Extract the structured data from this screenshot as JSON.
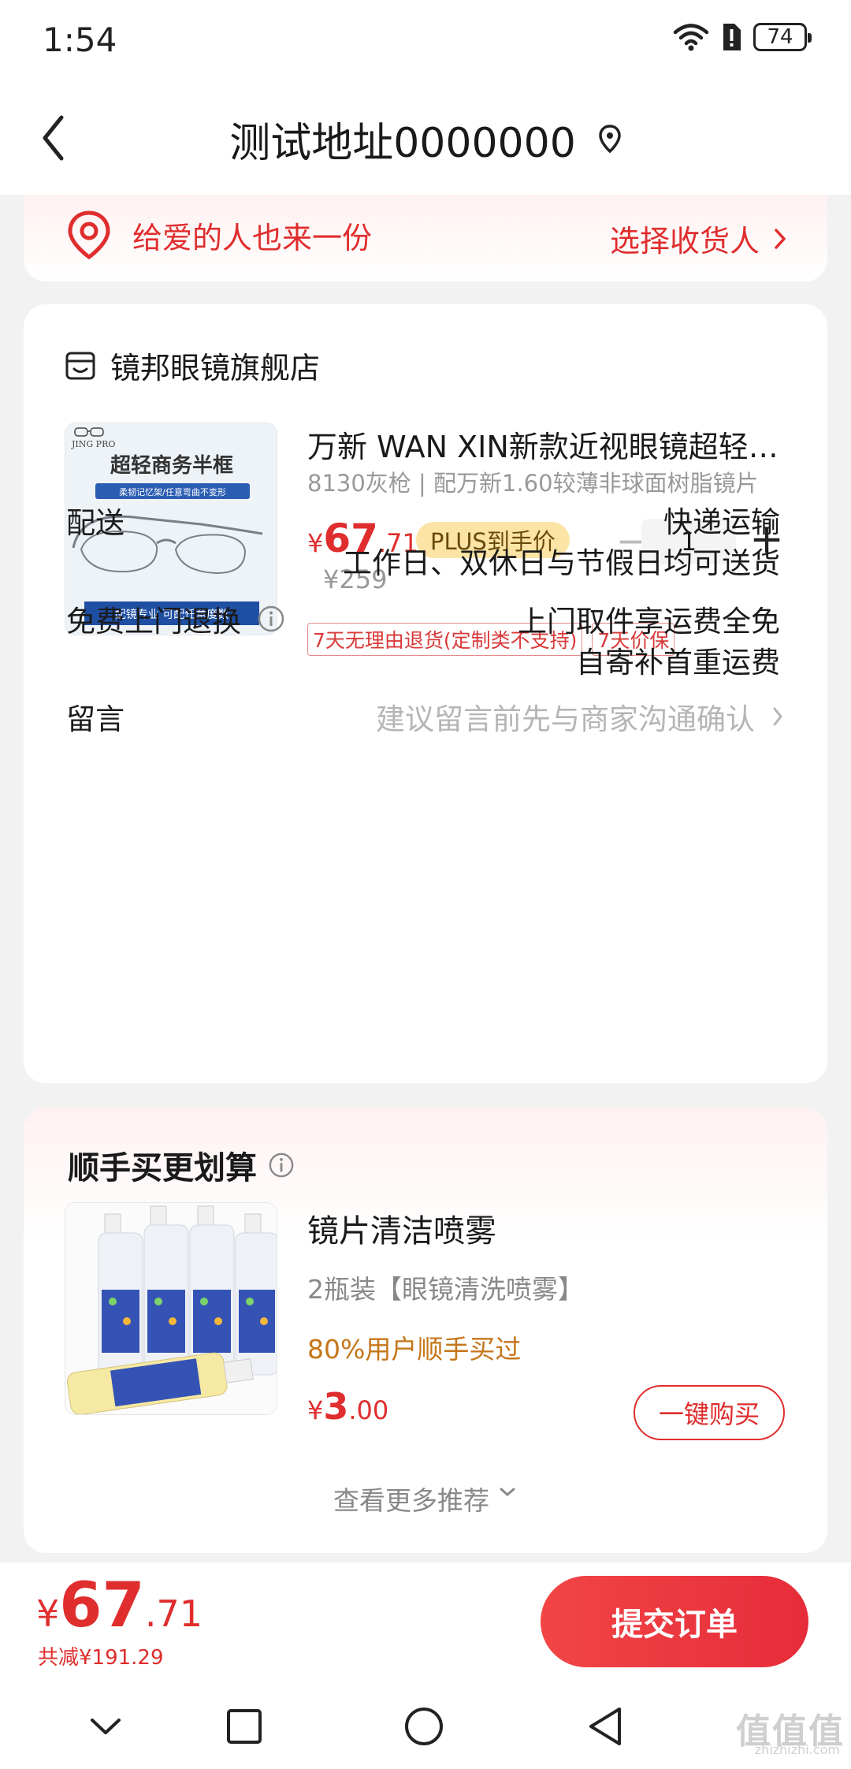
{
  "status_bar": {
    "time": "1:54",
    "battery": "74"
  },
  "header": {
    "title": "测试地址0000000"
  },
  "address_banner": {
    "left_text": "给爱的人也来一份",
    "right_text": "选择收货人"
  },
  "store": {
    "name": "镜邦眼镜旗舰店",
    "product": {
      "image_brand": "JING PRO",
      "image_headline": "超轻商务半框",
      "image_sub": "柔韧记忆架/任意弯曲不变形",
      "image_footer": "配镜专业 可配任意度数",
      "title": "万新 WAN XIN新款近视眼镜超轻商务半框",
      "spec": "8130灰枪 | 配万新1.60较薄非球面树脂镜片",
      "price_symbol": "¥",
      "price_int": "67",
      "price_dec": ".71",
      "plus_tag": "PLUS到手价",
      "quantity": "1",
      "minus_label": "−",
      "plus_label": "+",
      "original_price": "¥259",
      "tags": [
        "7天无理由退货(定制类不支持)",
        "7天价保"
      ]
    },
    "delivery": {
      "label": "配送",
      "value1": "快递运输",
      "value2": "工作日、双休日与节假日均可送货"
    },
    "return_service": {
      "label": "免费上门退换",
      "value1": "上门取件享运费全免",
      "value2": "自寄补首重运费"
    },
    "message": {
      "label": "留言",
      "placeholder": "建议留言前先与商家沟通确认"
    }
  },
  "recommend": {
    "title": "顺手买更划算",
    "item": {
      "name": "镜片清洁喷雾",
      "spec": "2瓶装【眼镜清洗喷雾】",
      "social": "80%用户顺手买过",
      "price_symbol": "¥",
      "price_int": "3",
      "price_dec": ".00",
      "buy_label": "一键购买"
    },
    "more_label": "查看更多推荐"
  },
  "bottom_bar": {
    "price_symbol": "¥",
    "price_int": "67",
    "price_dec": ".71",
    "saved": "共减¥191.29",
    "submit_label": "提交订单"
  },
  "watermark": {
    "text": "值值值",
    "sub": "zhizhizhi.com"
  },
  "colors": {
    "accent": "#e02d2d",
    "plus_tag_bg": "#fbe4a6",
    "social_orange": "#c5761a"
  }
}
